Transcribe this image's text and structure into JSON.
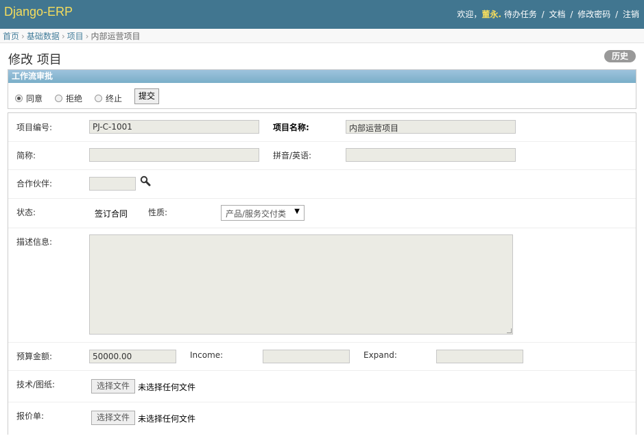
{
  "header": {
    "brand": "Django-ERP",
    "welcome": "欢迎，",
    "user_name": "董永.",
    "links": [
      "待办任务",
      "文档",
      "修改密码",
      "注销"
    ],
    "separator": "/"
  },
  "breadcrumbs": {
    "items": [
      "首页",
      "基础数据",
      "项目",
      "内部运营项目"
    ],
    "arrow": "›"
  },
  "page": {
    "title": "修改 项目",
    "history_label": "历史"
  },
  "workflow": {
    "title": "工作流审批",
    "options": [
      {
        "label": "同意",
        "checked": true
      },
      {
        "label": "拒绝",
        "checked": false
      },
      {
        "label": "终止",
        "checked": false
      }
    ],
    "submit_label": "提交"
  },
  "form": {
    "project_code": {
      "label": "项目编号:",
      "value": "PJ-C-1001"
    },
    "project_name": {
      "label": "项目名称:",
      "value": "内部运营项目"
    },
    "short_name": {
      "label": "简称:",
      "value": ""
    },
    "pinyin": {
      "label": "拼音/英语:",
      "value": ""
    },
    "partner": {
      "label": "合作伙伴:",
      "value": ""
    },
    "status": {
      "label": "状态:",
      "value": "签订合同"
    },
    "nature": {
      "label": "性质:",
      "value": "产品/服务交付类"
    },
    "description": {
      "label": "描述信息:",
      "value": ""
    },
    "budget": {
      "label": "预算金额:",
      "value": "50000.00"
    },
    "income": {
      "label": "Income:",
      "value": ""
    },
    "expand": {
      "label": "Expand:",
      "value": ""
    },
    "tech_drawing": {
      "label": "技术/图纸:",
      "button": "选择文件",
      "status": "未选择任何文件"
    },
    "quotation": {
      "label": "报价单:",
      "button": "选择文件",
      "status": "未选择任何文件"
    }
  },
  "icons": {
    "search": "magnifier-icon"
  }
}
